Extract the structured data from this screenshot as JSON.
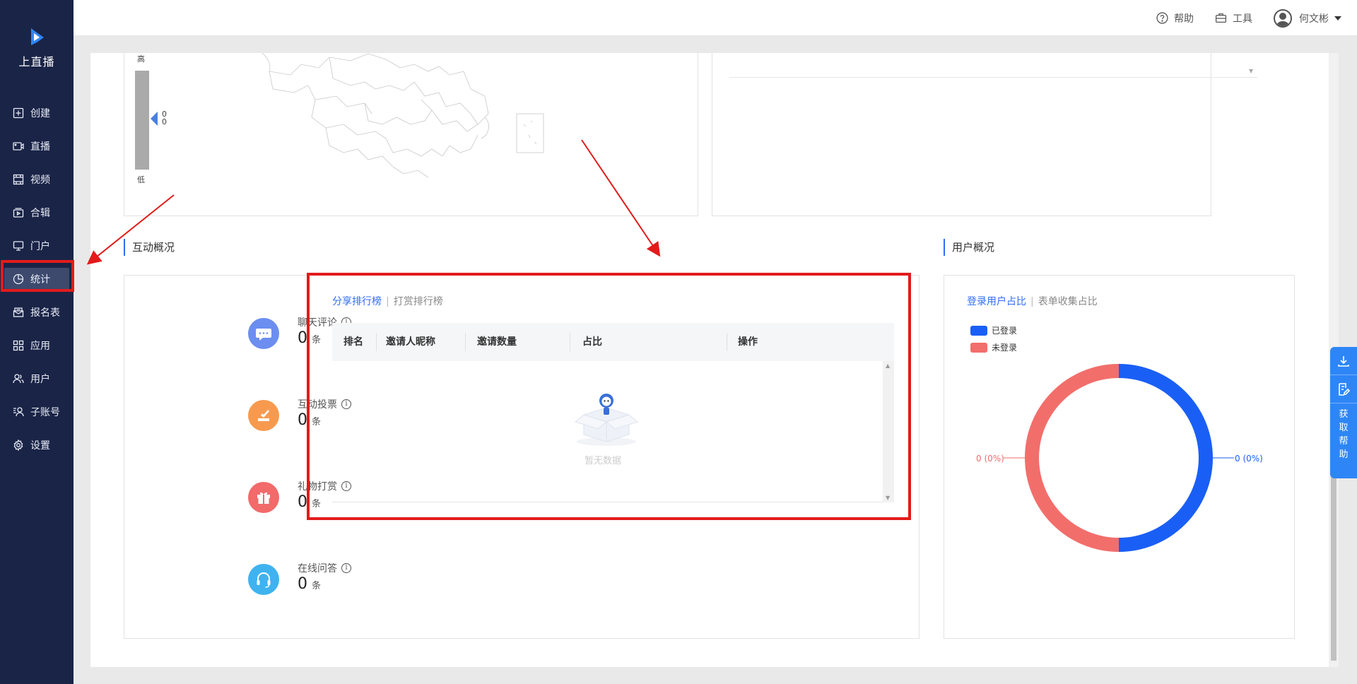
{
  "brand": {
    "name": "上直播"
  },
  "sidebar": {
    "items": [
      {
        "label": "创建",
        "icon": "plus-square-icon"
      },
      {
        "label": "直播",
        "icon": "video-camera-icon"
      },
      {
        "label": "视频",
        "icon": "film-icon"
      },
      {
        "label": "合辑",
        "icon": "collection-play-icon"
      },
      {
        "label": "门户",
        "icon": "monitor-icon"
      },
      {
        "label": "统计",
        "icon": "pie-chart-icon",
        "active": true
      },
      {
        "label": "报名表",
        "icon": "mail-form-icon"
      },
      {
        "label": "应用",
        "icon": "apps-grid-icon"
      },
      {
        "label": "用户",
        "icon": "users-icon"
      },
      {
        "label": "子账号",
        "icon": "sub-account-icon"
      },
      {
        "label": "设置",
        "icon": "gear-icon"
      }
    ]
  },
  "topbar": {
    "help": "帮助",
    "tools": "工具",
    "username": "何文彬"
  },
  "map_panel": {
    "legend_high": "高",
    "legend_low": "低",
    "legend_value_1": "0",
    "legend_value_2": "0"
  },
  "interaction": {
    "title": "互动概况",
    "stats": [
      {
        "label": "聊天评论",
        "value": "0",
        "unit": "条",
        "color": "#6b8ef0",
        "icon": "chat-bubble-icon"
      },
      {
        "label": "互动投票",
        "value": "0",
        "unit": "条",
        "color": "#f79a50",
        "icon": "vote-icon"
      },
      {
        "label": "礼物打赏",
        "value": "0",
        "unit": "条",
        "color": "#f26a6a",
        "icon": "gift-icon"
      },
      {
        "label": "在线问答",
        "value": "0",
        "unit": "条",
        "color": "#3fb3f0",
        "icon": "headset-icon"
      }
    ],
    "tabs": {
      "active": "分享排行榜",
      "inactive": "打赏排行榜"
    },
    "table": {
      "columns": [
        "排名",
        "邀请人昵称",
        "邀请数量",
        "占比",
        "操作"
      ],
      "empty_text": "暂无数据"
    }
  },
  "user_overview": {
    "title": "用户概况",
    "tabs": {
      "active": "登录用户占比",
      "inactive": "表单收集占比"
    },
    "legend": [
      {
        "name": "已登录",
        "color": "#1a5ff5"
      },
      {
        "name": "未登录",
        "color": "#f26e6b"
      }
    ],
    "slices": [
      {
        "name": "已登录",
        "value": 0,
        "label": "0 (0%)",
        "color": "#1a5ff5"
      },
      {
        "name": "未登录",
        "value": 0,
        "label": "0 (0%)",
        "color": "#f26e6b"
      }
    ]
  },
  "float_help": {
    "label": "获取帮助"
  }
}
